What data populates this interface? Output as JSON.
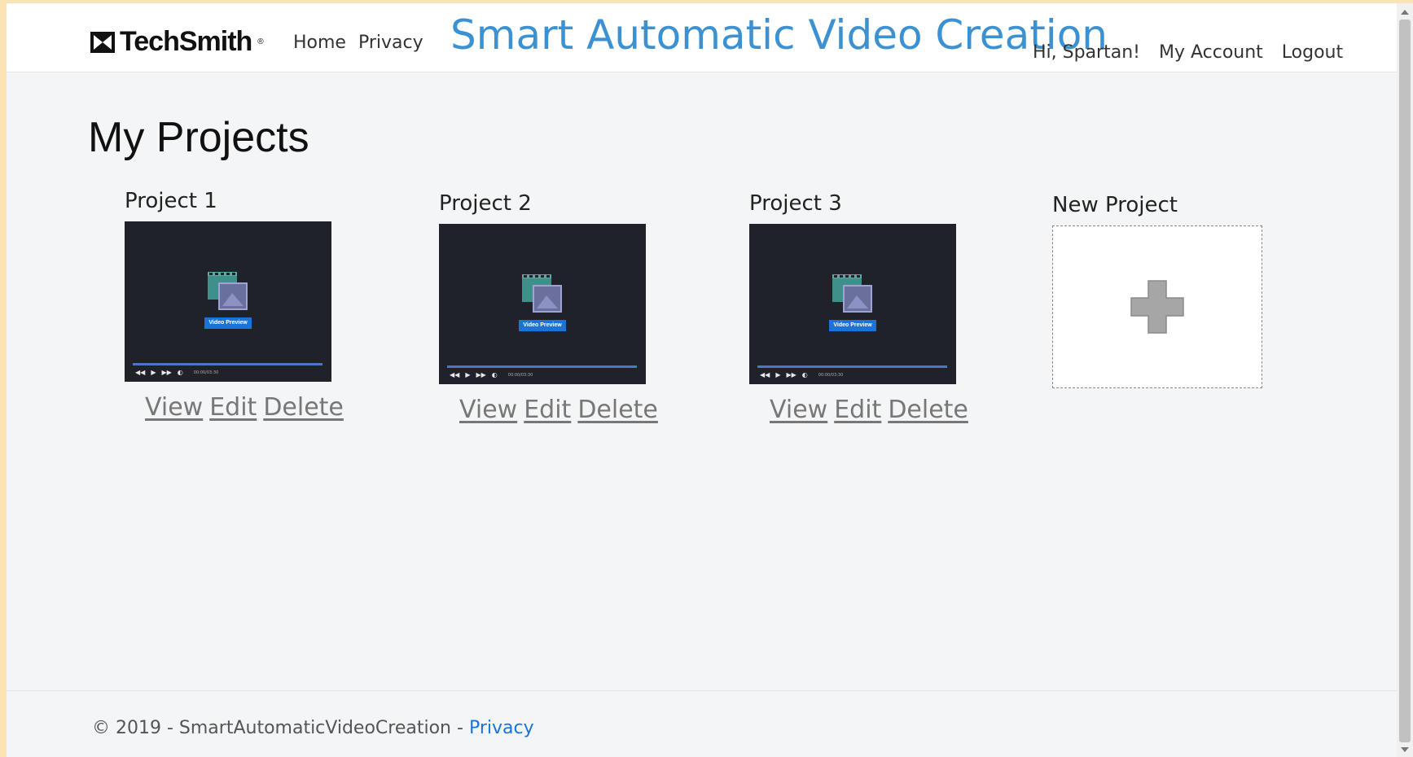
{
  "header": {
    "brand": "TechSmith",
    "brand_reg": "®",
    "nav": {
      "home": "Home",
      "privacy": "Privacy"
    },
    "site_title": "Smart Automatic Video Creation",
    "user": {
      "greeting": "Hi, Spartan!",
      "account": "My Account",
      "logout": "Logout"
    }
  },
  "main": {
    "heading": "My Projects",
    "projects": [
      {
        "title": "Project 1",
        "preview_label": "Video Preview",
        "time": "00:00/03:30",
        "view": "View",
        "edit": "Edit",
        "delete": "Delete"
      },
      {
        "title": "Project 2",
        "preview_label": "Video Preview",
        "time": "00:00/03:30",
        "view": "View",
        "edit": "Edit",
        "delete": "Delete"
      },
      {
        "title": "Project 3",
        "preview_label": "Video Preview",
        "time": "00:00/03:30",
        "view": "View",
        "edit": "Edit",
        "delete": "Delete"
      }
    ],
    "new_project": {
      "title": "New Project"
    }
  },
  "footer": {
    "copyright": "© 2019 - SmartAutomaticVideoCreation - ",
    "privacy": "Privacy"
  },
  "colors": {
    "title_blue": "#3b91d1",
    "link_blue": "#1a73d9",
    "page_bg": "#f4f5f6",
    "outer_bg": "#fbe3b4"
  }
}
